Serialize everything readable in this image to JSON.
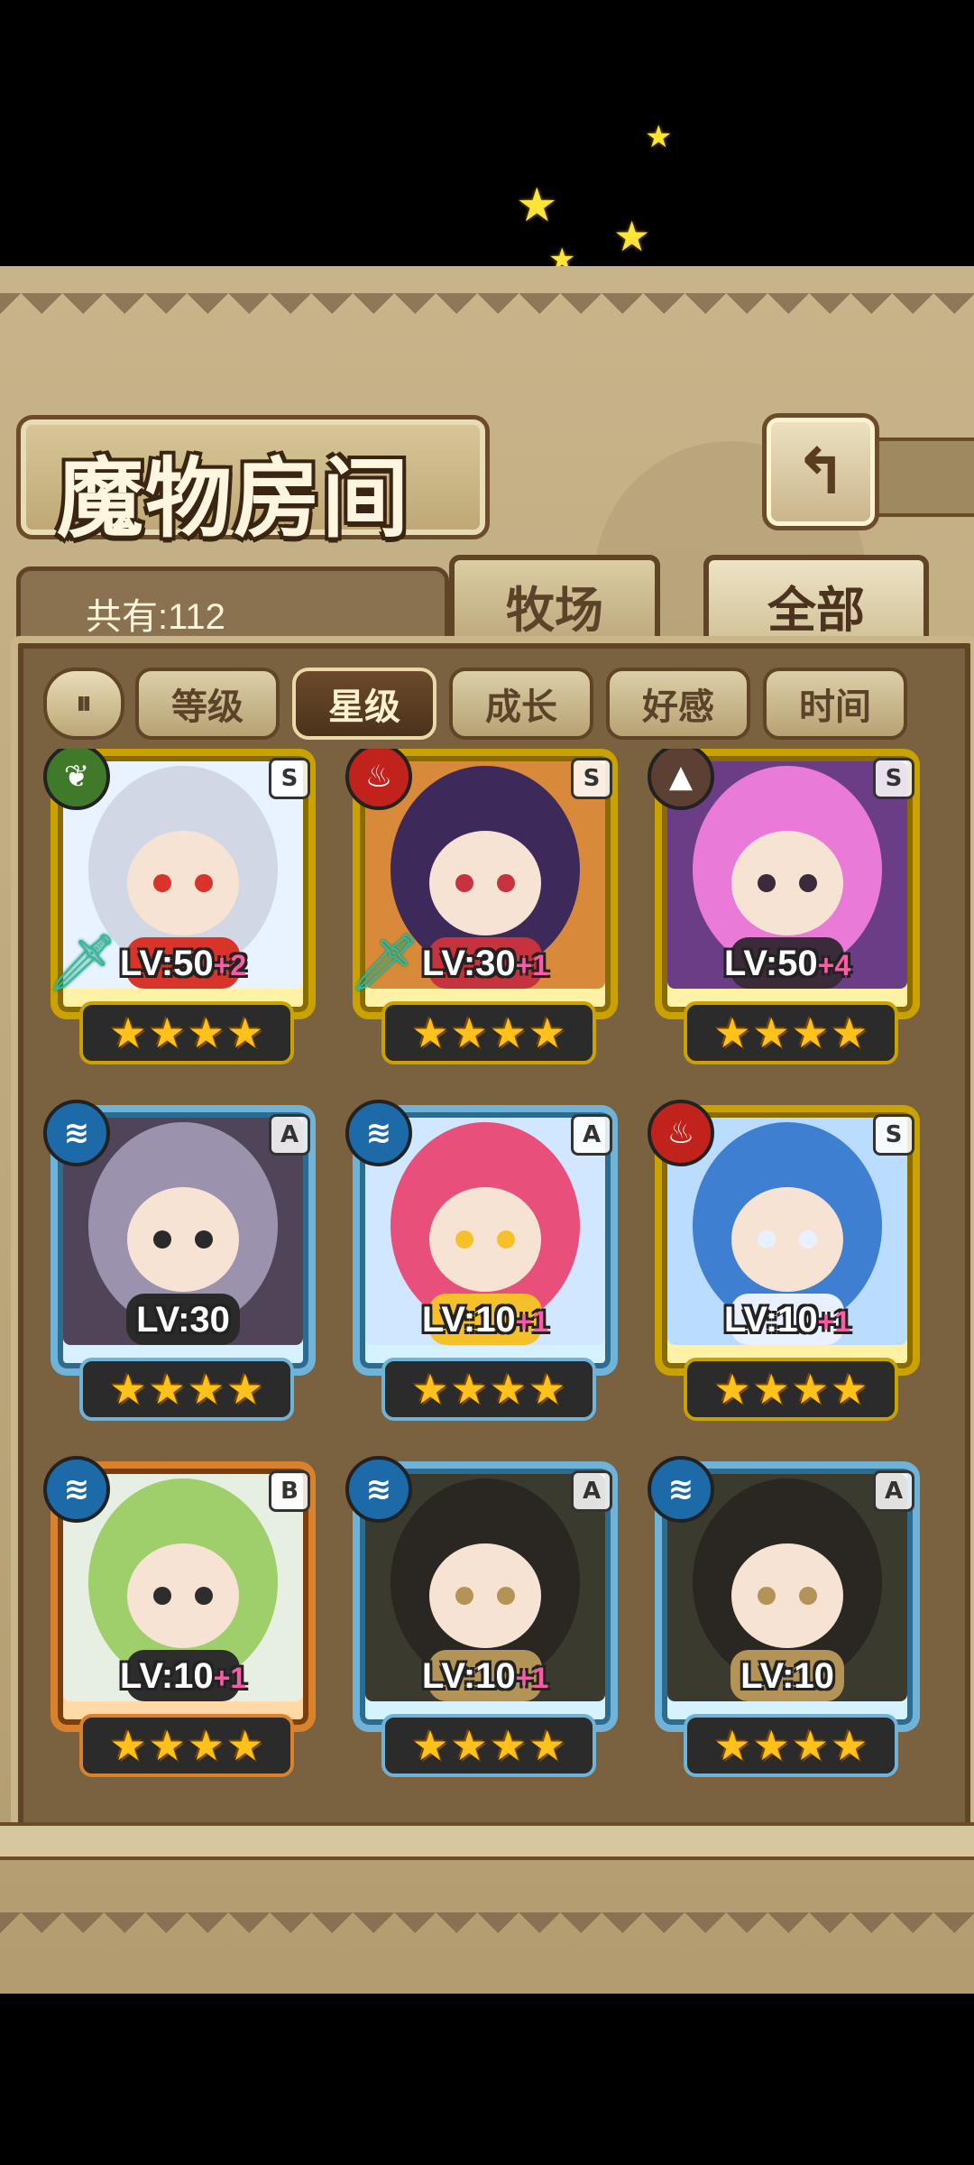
{
  "header": {
    "title": "魔物房间",
    "back_label": "↰"
  },
  "count": {
    "label": "共有:112"
  },
  "tabs": [
    {
      "label": "牧场",
      "active": false
    },
    {
      "label": "全部",
      "active": true
    }
  ],
  "sort_toggle_label": "⏸",
  "filters": [
    {
      "label": "等级",
      "active": false
    },
    {
      "label": "星级",
      "active": true
    },
    {
      "label": "成长",
      "active": false
    },
    {
      "label": "好感",
      "active": false
    },
    {
      "label": "时间",
      "active": false
    }
  ],
  "monsters": [
    {
      "element": "nature",
      "element_glyph": "❦",
      "rank": "S",
      "frame": "gold",
      "level": "LV:50",
      "plus": "+2",
      "has_weapon": true,
      "stars": 4,
      "palette": [
        "#e8f3ff",
        "#d2d7e6",
        "#d8342a"
      ]
    },
    {
      "element": "fire",
      "element_glyph": "♨",
      "rank": "S",
      "frame": "gold",
      "level": "LV:30",
      "plus": "+1",
      "has_weapon": true,
      "stars": 4,
      "palette": [
        "#d88a3a",
        "#3d2a5a",
        "#c6323d"
      ]
    },
    {
      "element": "earth",
      "element_glyph": "▲",
      "rank": "S",
      "frame": "gold",
      "level": "LV:50",
      "plus": "+4",
      "has_weapon": false,
      "stars": 4,
      "palette": [
        "#6b3d86",
        "#ea7ad8",
        "#3b2a3a"
      ]
    },
    {
      "element": "water",
      "element_glyph": "≋",
      "rank": "A",
      "frame": "blue",
      "level": "LV:30",
      "plus": "",
      "has_weapon": false,
      "stars": 4,
      "palette": [
        "#4f4458",
        "#9b93ad",
        "#2a2a2a"
      ]
    },
    {
      "element": "water",
      "element_glyph": "≋",
      "rank": "A",
      "frame": "blue",
      "level": "LV:10",
      "plus": "+1",
      "has_weapon": false,
      "stars": 4,
      "palette": [
        "#d0e7ff",
        "#e94f7b",
        "#f5c12a"
      ]
    },
    {
      "element": "fire",
      "element_glyph": "♨",
      "rank": "S",
      "frame": "gold",
      "level": "LV:10",
      "plus": "+1",
      "has_weapon": false,
      "stars": 4,
      "palette": [
        "#b9dcff",
        "#3f7fd1",
        "#e9f0ff"
      ]
    },
    {
      "element": "water",
      "element_glyph": "≋",
      "rank": "B",
      "frame": "orange",
      "level": "LV:10",
      "plus": "+1",
      "has_weapon": false,
      "stars": 4,
      "palette": [
        "#e7efe2",
        "#9fcf6b",
        "#2d2d2d"
      ]
    },
    {
      "element": "water",
      "element_glyph": "≋",
      "rank": "A",
      "frame": "blue",
      "level": "LV:10",
      "plus": "+1",
      "has_weapon": false,
      "stars": 4,
      "palette": [
        "#3b3a2f",
        "#2a2622",
        "#b49456"
      ]
    },
    {
      "element": "water",
      "element_glyph": "≋",
      "rank": "A",
      "frame": "blue",
      "level": "LV:10",
      "plus": "",
      "has_weapon": false,
      "stars": 4,
      "palette": [
        "#3b3a2f",
        "#2a2622",
        "#b49456"
      ]
    }
  ]
}
